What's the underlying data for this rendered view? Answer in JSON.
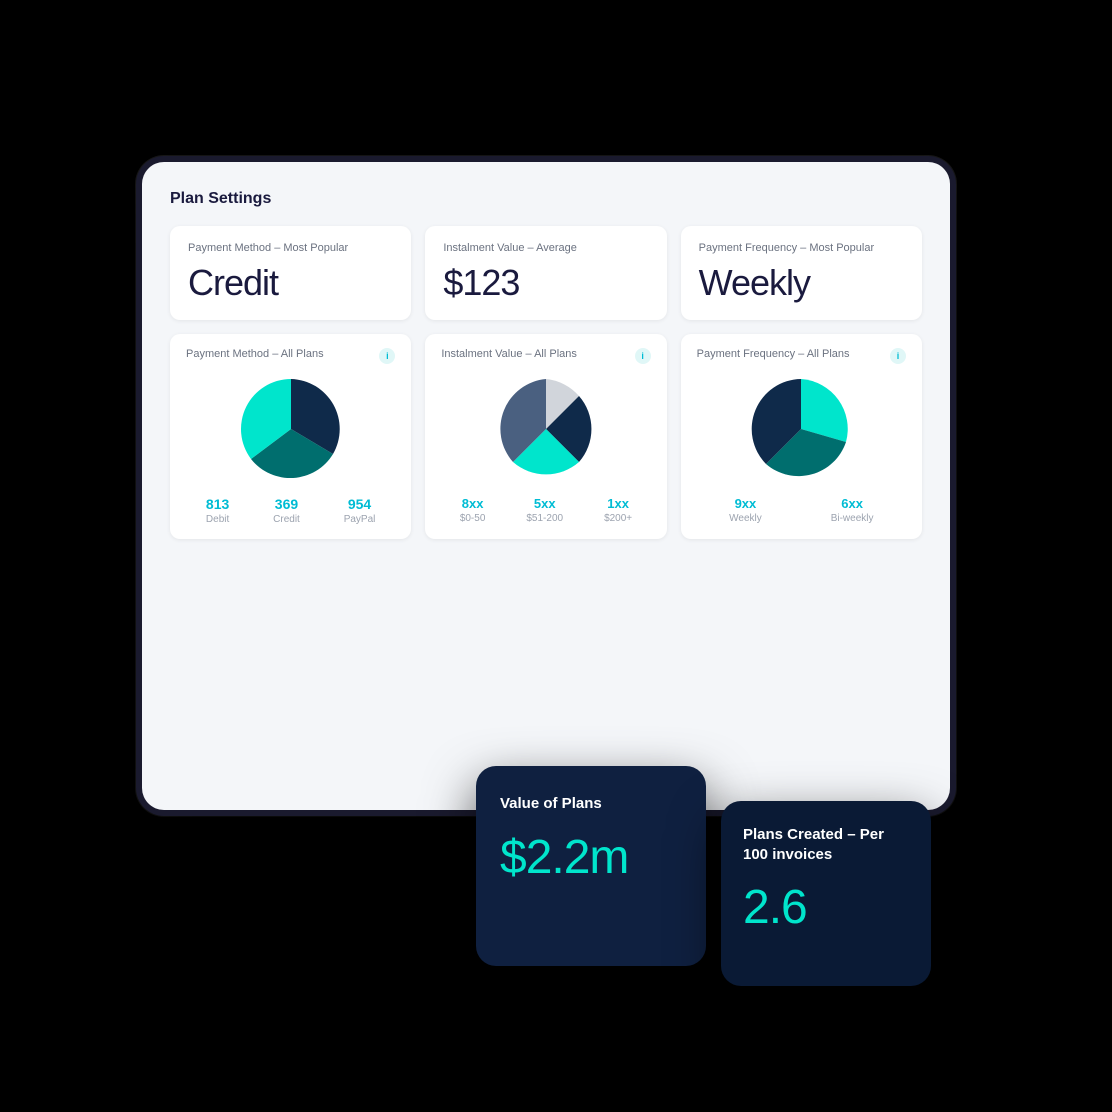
{
  "page": {
    "title": "Plan Settings"
  },
  "stats": [
    {
      "label": "Payment Method – Most Popular",
      "value": "Credit"
    },
    {
      "label": "Instalment Value – Average",
      "value": "$123"
    },
    {
      "label": "Payment Frequency – Most Popular",
      "value": "Weekly"
    }
  ],
  "charts": [
    {
      "label": "Payment Method – All Plans",
      "info": "i",
      "legend": [
        {
          "value": "813",
          "label": "Debit"
        },
        {
          "value": "369",
          "label": "Credit"
        },
        {
          "value": "954",
          "label": "PayPal"
        }
      ]
    },
    {
      "label": "Instalment Value – All Plans",
      "info": "i",
      "legend": [
        {
          "value": "8...",
          "label": "$0-5"
        },
        {
          "value": "...",
          "label": "..."
        },
        {
          "value": "1",
          "label": "..."
        }
      ]
    },
    {
      "label": "Payment Frequency – All Plans",
      "info": "i",
      "legend": [
        {
          "value": "...",
          "label": "B..."
        },
        {
          "value": "...",
          "label": "..."
        }
      ]
    }
  ],
  "floating_cards": [
    {
      "id": "value-of-plans",
      "title": "Value of Plans",
      "value": "$2.2m"
    },
    {
      "id": "plans-created",
      "title": "Plans Created – Per 100 invoices",
      "value": "2.6"
    }
  ]
}
